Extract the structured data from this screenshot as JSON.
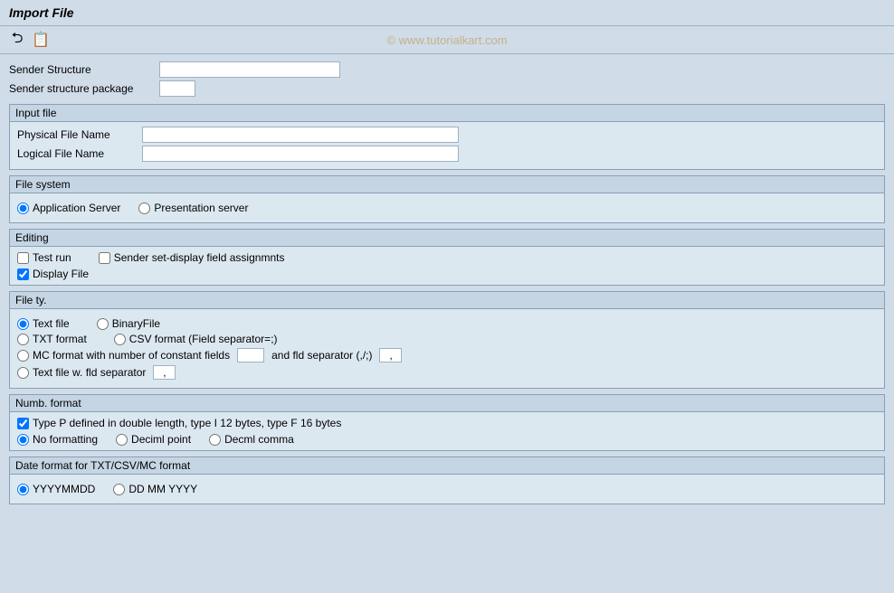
{
  "title": "Import File",
  "watermark": "© www.tutorialkart.com",
  "toolbar": {
    "icon1": "↩",
    "icon2": "📋"
  },
  "top_fields": {
    "sender_structure_label": "Sender Structure",
    "sender_structure_package_label": "Sender structure package",
    "sender_structure_value": "",
    "sender_structure_package_value": ""
  },
  "input_file": {
    "section_label": "Input file",
    "physical_file_name_label": "Physical File Name",
    "logical_file_name_label": "Logical File Name",
    "physical_file_name_value": "",
    "logical_file_name_value": ""
  },
  "file_system": {
    "section_label": "File system",
    "options": [
      "Application Server",
      "Presentation server"
    ],
    "selected": 0
  },
  "editing": {
    "section_label": "Editing",
    "test_run_label": "Test run",
    "sender_set_display_label": "Sender set-display field assignmnts",
    "display_file_label": "Display File",
    "test_run_checked": false,
    "sender_set_checked": false,
    "display_file_checked": true
  },
  "file_type": {
    "section_label": "File ty.",
    "options_row1": [
      "Text file",
      "BinaryFile"
    ],
    "options_row2": [
      "TXT format",
      "CSV format (Field separator=;)"
    ],
    "mc_label": "MC format with number of constant fields",
    "mc_and_label": "and fld separator (,/;)",
    "mc_value": "",
    "mc_sep_value": ",",
    "text_fld_label": "Text file w. fld separator",
    "text_fld_sep_value": ",",
    "selected": 0
  },
  "numb_format": {
    "section_label": "Numb. format",
    "checkbox_label": "Type P defined in double length, type I 12 bytes, type F 16 bytes",
    "checkbox_checked": true,
    "options": [
      "No formatting",
      "Deciml point",
      "Decml comma"
    ],
    "selected": 0
  },
  "date_format": {
    "section_label": "Date format for TXT/CSV/MC format",
    "options": [
      "YYYYMMDD",
      "DD MM YYYY"
    ],
    "selected": 0
  }
}
